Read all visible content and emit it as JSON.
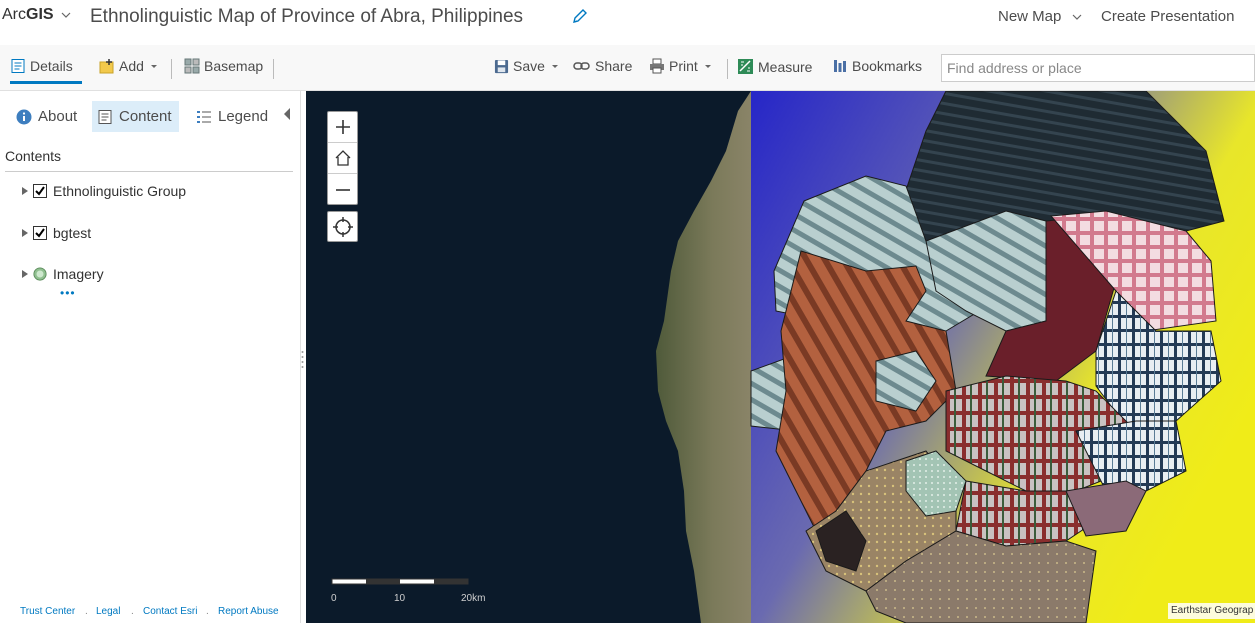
{
  "header": {
    "brand_prefix": "Arc",
    "brand_bold": "GIS",
    "title": "Ethnolinguistic Map of Province of Abra, Philippines",
    "new_map": "New Map",
    "create_presentation": "Create Presentation"
  },
  "toolbar": {
    "details": "Details",
    "add": "Add",
    "basemap": "Basemap",
    "save": "Save",
    "share": "Share",
    "print": "Print",
    "measure": "Measure",
    "bookmarks": "Bookmarks",
    "search_placeholder": "Find address or place"
  },
  "panel": {
    "tabs": [
      {
        "label": "About",
        "icon": "info-icon"
      },
      {
        "label": "Content",
        "icon": "content-icon",
        "selected": true
      },
      {
        "label": "Legend",
        "icon": "legend-icon"
      }
    ],
    "contents_label": "Contents",
    "layers": [
      {
        "name": "Ethnolinguistic Group",
        "checked": true
      },
      {
        "name": "bgtest",
        "checked": true
      },
      {
        "name": "Imagery",
        "icon": "globe-icon"
      }
    ],
    "more": "•••",
    "footer": [
      "Trust Center",
      "Legal",
      "Contact Esri",
      "Report Abuse"
    ]
  },
  "map": {
    "scale_labels": [
      "0",
      "10",
      "20km"
    ],
    "attribution": "Earthstar Geograp"
  },
  "colors": {
    "accent": "#0079c1",
    "selected_tab_bg": "#dcedf9",
    "ocean": "#0b1a2a",
    "overlay_yellow": "#f0ec18",
    "overlay_blue": "#2626c8"
  }
}
